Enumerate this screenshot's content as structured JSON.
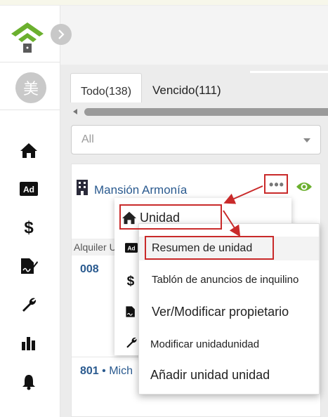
{
  "sidebar": {
    "avatar_char": "美",
    "nav": [
      "home-icon",
      "ad-icon",
      "dollar-icon",
      "signature-icon",
      "wrench-icon",
      "chart-icon",
      "bell-icon"
    ]
  },
  "tabs": [
    {
      "label": "Todo(138)",
      "active": true
    },
    {
      "label": "Vencido(111)",
      "active": false
    }
  ],
  "filter": {
    "value": "All"
  },
  "property": {
    "name": "Mansión Armonía",
    "more": "•••"
  },
  "list": {
    "under_label": "Alquiler U",
    "unit1": "008",
    "unit2_num": "801",
    "unit2_rest": " • Mich"
  },
  "menu_primary": {
    "label": "Unidad",
    "icon": "home-icon"
  },
  "menu_sub": [
    "Resumen de unidad",
    "Tablón de anuncios de inquilino",
    "Ver/Modificar propietario",
    "Modificar unidadunidad",
    "Añadir unidad unidad"
  ],
  "colors": {
    "brand_green": "#6bb02e",
    "link_blue": "#2a5a8f",
    "annotation_red": "#c92a2a"
  }
}
